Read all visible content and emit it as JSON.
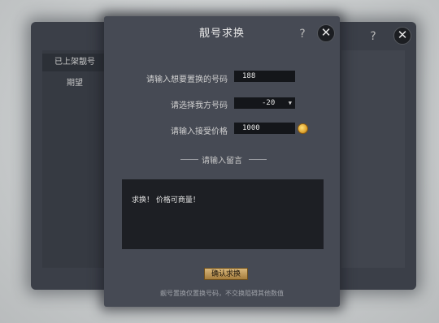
{
  "background_panel": {
    "sidebar_items": [
      {
        "label": "已上架靓号",
        "active": true
      },
      {
        "label": "期望",
        "active": false
      }
    ],
    "help_label": "?",
    "close_label": "✕"
  },
  "dialog": {
    "title": "靓号求换",
    "help_label": "?",
    "close_label": "✕",
    "fields": {
      "desired_number": {
        "label": "请输入想要置换的号码",
        "value": "188"
      },
      "my_number": {
        "label": "请选择我方号码",
        "value": "-20",
        "arrow": "▼"
      },
      "price": {
        "label": "请输入接受价格",
        "value": "1000",
        "icon": "gold-coin-icon"
      }
    },
    "message_section_label": "请输入留言",
    "message_text": "求换！ 价格可商量！",
    "confirm_label": "确认求换",
    "footnote": "靓号置换仅置换号码，不交换阻碍其他数值"
  },
  "colors": {
    "accent_gold": "#c9a062",
    "panel": "#464a54",
    "field": "#14161a"
  }
}
